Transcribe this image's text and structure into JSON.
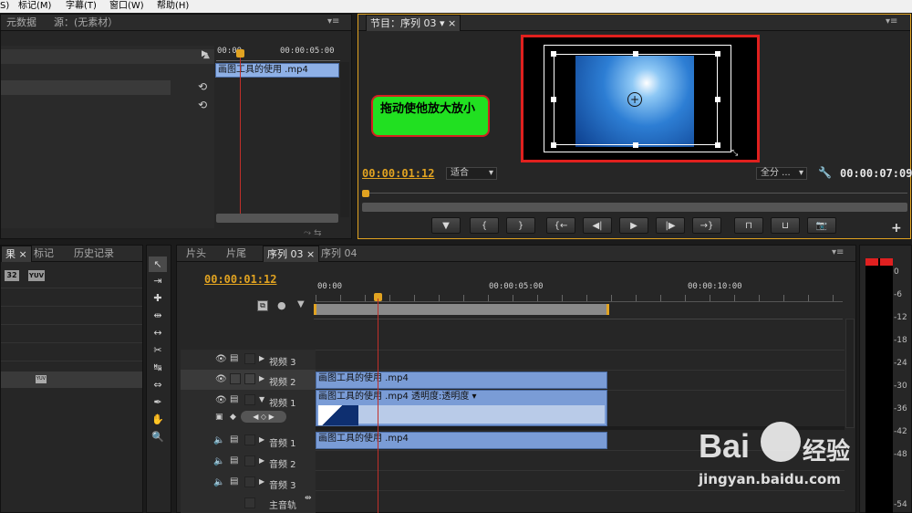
{
  "menubar": {
    "items": [
      "S)",
      "标记(M)",
      "字幕(T)",
      "窗口(W)",
      "帮助(H)"
    ]
  },
  "source_panel": {
    "tabs": [
      "元数据",
      "源：(无素材）"
    ],
    "ruler": {
      "start": "00:00",
      "end": "00:00:05:00"
    },
    "clip_name": "画图工具的使用 .mp4"
  },
  "program_monitor": {
    "tab_label": "节目：序列 03",
    "callout_text": "拖动使他放大放小",
    "current_time": "00:00:01:12",
    "fit_label": "适合",
    "resolution_label": "全分 ...",
    "duration": "00:00:07:09",
    "accent": "#e1a321",
    "callout_bg": "#21e021",
    "highlight_border": "#e0201e"
  },
  "effects_panel": {
    "tabs": [
      "果",
      "标记",
      "历史记录"
    ],
    "badges": [
      "32",
      "YUV",
      "YUV"
    ]
  },
  "tools": {
    "icons": [
      "selection-tool-icon",
      "track-select-tool-icon",
      "ripple-edit-tool-icon",
      "rolling-edit-tool-icon",
      "rate-stretch-tool-icon",
      "razor-tool-icon",
      "slip-tool-icon",
      "slide-tool-icon",
      "pen-tool-icon",
      "hand-tool-icon",
      "zoom-tool-icon"
    ]
  },
  "timeline": {
    "tabs": [
      "片头",
      "片尾",
      "序列 03",
      "序列 04"
    ],
    "current_time": "00:00:01:12",
    "ruler": [
      "00:00",
      "00:00:05:00",
      "00:00:10:00"
    ],
    "tracks": {
      "video3": "视频 3",
      "video2": "视频 2",
      "video1": "视频 1",
      "audio1": "音频 1",
      "audio2": "音频 2",
      "audio3": "音频 3",
      "master": "主音轨"
    },
    "clips": {
      "video2": "画图工具的使用 .mp4",
      "video1": "画图工具的使用 .mp4  透明度:透明度 ▾",
      "audio1": "画图工具的使用 .mp4"
    }
  },
  "audio_meter": {
    "labels": [
      "0",
      "-6",
      "-12",
      "-18",
      "-24",
      "-30",
      "-36",
      "-42",
      "-48",
      "-54"
    ]
  },
  "watermark": {
    "text": "Bai",
    "text2": "经验",
    "url": "jingyan.baidu.com"
  }
}
